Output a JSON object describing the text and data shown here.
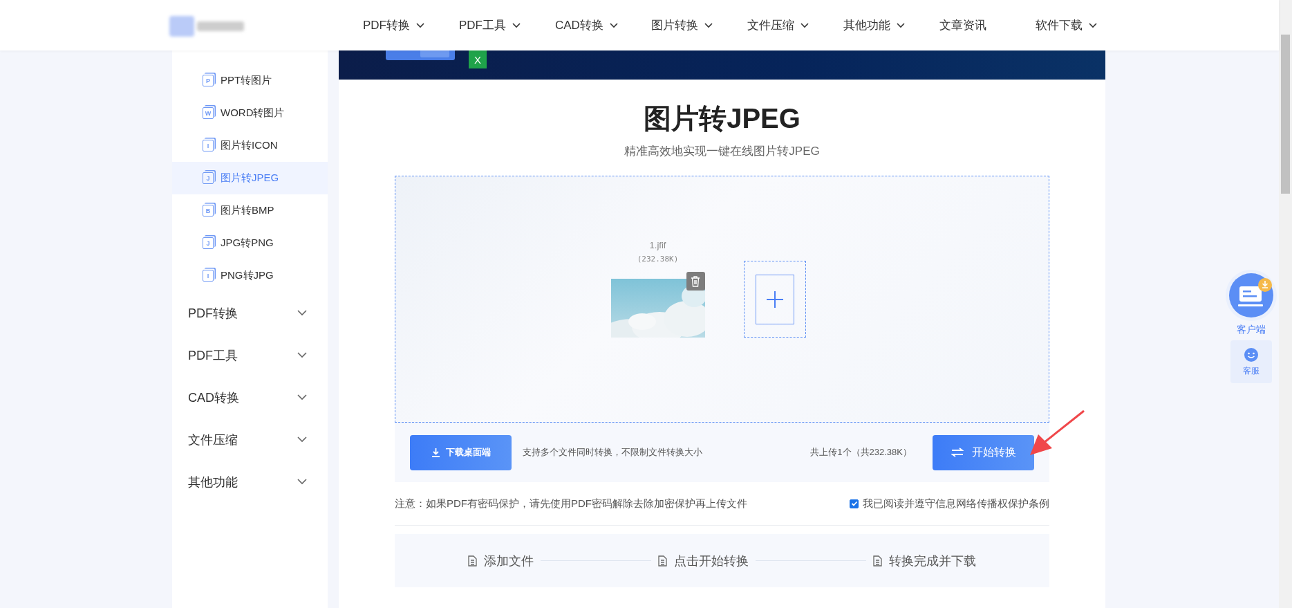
{
  "nav": [
    {
      "label": "PDF转换",
      "dropdown": true
    },
    {
      "label": "PDF工具",
      "dropdown": true
    },
    {
      "label": "CAD转换",
      "dropdown": true
    },
    {
      "label": "图片转换",
      "dropdown": true
    },
    {
      "label": "文件压缩",
      "dropdown": true
    },
    {
      "label": "其他功能",
      "dropdown": true
    },
    {
      "label": "文章资讯",
      "dropdown": false
    },
    {
      "label": "软件下载",
      "dropdown": true
    }
  ],
  "sidebar": {
    "items": [
      {
        "label": "PPT转图片",
        "glyph": "P",
        "selected": false
      },
      {
        "label": "WORD转图片",
        "glyph": "W",
        "selected": false
      },
      {
        "label": "图片转ICON",
        "glyph": "I",
        "selected": false
      },
      {
        "label": "图片转JPEG",
        "glyph": "J",
        "selected": true
      },
      {
        "label": "图片转BMP",
        "glyph": "B",
        "selected": false
      },
      {
        "label": "JPG转PNG",
        "glyph": "J",
        "selected": false
      },
      {
        "label": "PNG转JPG",
        "glyph": "I",
        "selected": false
      }
    ],
    "groups": [
      {
        "label": "PDF转换",
        "expanded": false
      },
      {
        "label": "PDF工具",
        "expanded": false
      },
      {
        "label": "CAD转换",
        "expanded": false
      },
      {
        "label": "文件压缩",
        "expanded": false
      },
      {
        "label": "其他功能",
        "expanded": false
      }
    ]
  },
  "banner": {
    "badge": "X"
  },
  "title": "图片转JPEG",
  "subtitle": "精准高效地实现一键在线图片转JPEG",
  "files": [
    {
      "name": "1.jfif",
      "size": "(232.38K)",
      "kind": "picture"
    }
  ],
  "toolbar": {
    "download_button": "下载桌面端",
    "hint": "支持多个文件同时转换，不限制文件转换大小",
    "summary": "共上传1个（共232.38K）",
    "start_button": "开始转换"
  },
  "notice": "注意：如果PDF有密码保护，请先使用PDF密码解除去除加密保护再上传文件",
  "agreement": {
    "label": "我已阅读并遵守信息网络传播权保护条例",
    "checked": true
  },
  "steps": [
    "添加文件",
    "点击开始转换",
    "转换完成并下载"
  ],
  "float": {
    "client_label": "客户端",
    "service_label": "客服"
  }
}
